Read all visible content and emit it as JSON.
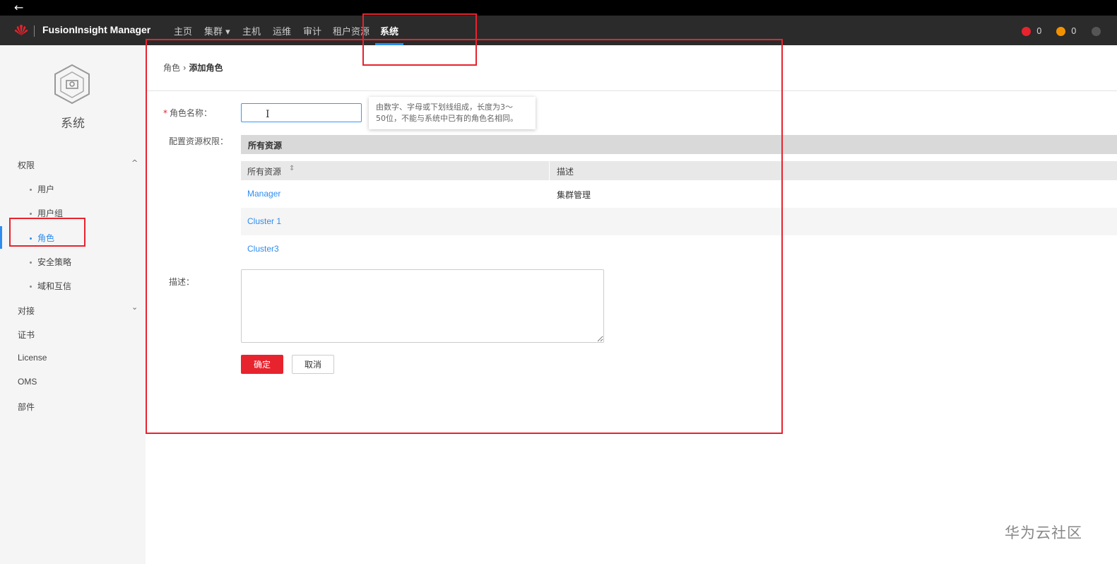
{
  "app": {
    "title": "FusionInsight Manager",
    "back_icon": "←"
  },
  "topnav": {
    "items": [
      {
        "label": "主页"
      },
      {
        "label": "集群 ▾"
      },
      {
        "label": "主机"
      },
      {
        "label": "运维"
      },
      {
        "label": "审计"
      },
      {
        "label": "租户资源"
      },
      {
        "label": "系统"
      }
    ],
    "active": "系统",
    "alarms": [
      {
        "count": "0",
        "color": "#e7232e"
      },
      {
        "count": "0",
        "color": "#f29100"
      }
    ]
  },
  "sidebar": {
    "title": "系统",
    "groups": [
      {
        "label": "权限",
        "expanded": true
      },
      {
        "label": "对接",
        "expanded": false
      },
      {
        "label": "证书"
      },
      {
        "label": "License"
      },
      {
        "label": "OMS"
      },
      {
        "label": "部件"
      }
    ],
    "permission_items": [
      "用户",
      "用户组",
      "角色",
      "安全策略",
      "域和互信"
    ],
    "active_item": "角色",
    "chevron_up": "^",
    "chevron_down": "⌄"
  },
  "breadcrumb": {
    "parent": "角色",
    "separator": "›",
    "current": "添加角色"
  },
  "form": {
    "role_name_label": "角色名称：",
    "required_mark": "*",
    "role_name_value": "",
    "cursor_glyph": "I",
    "tooltip_line1": "由数字、字母或下划线组成，长度为3～",
    "tooltip_line2": "50位，不能与系统中已有的角色名相同。",
    "permission_label": "配置资源权限：",
    "resource_header": "所有资源",
    "table": {
      "columns": [
        "所有资源",
        "描述"
      ],
      "sort_icon": "⇕",
      "rows": [
        {
          "resource": "Manager",
          "description": "集群管理"
        },
        {
          "resource": "Cluster 1",
          "description": ""
        },
        {
          "resource": "Cluster3",
          "description": ""
        }
      ]
    },
    "description_label": "描述：",
    "ok_label": "确定",
    "cancel_label": "取消"
  },
  "watermark": "华为云社区",
  "colors": {
    "accent": "#2d8cf0",
    "brand_red": "#e7232e",
    "nav_bg": "#2b2b2b"
  }
}
